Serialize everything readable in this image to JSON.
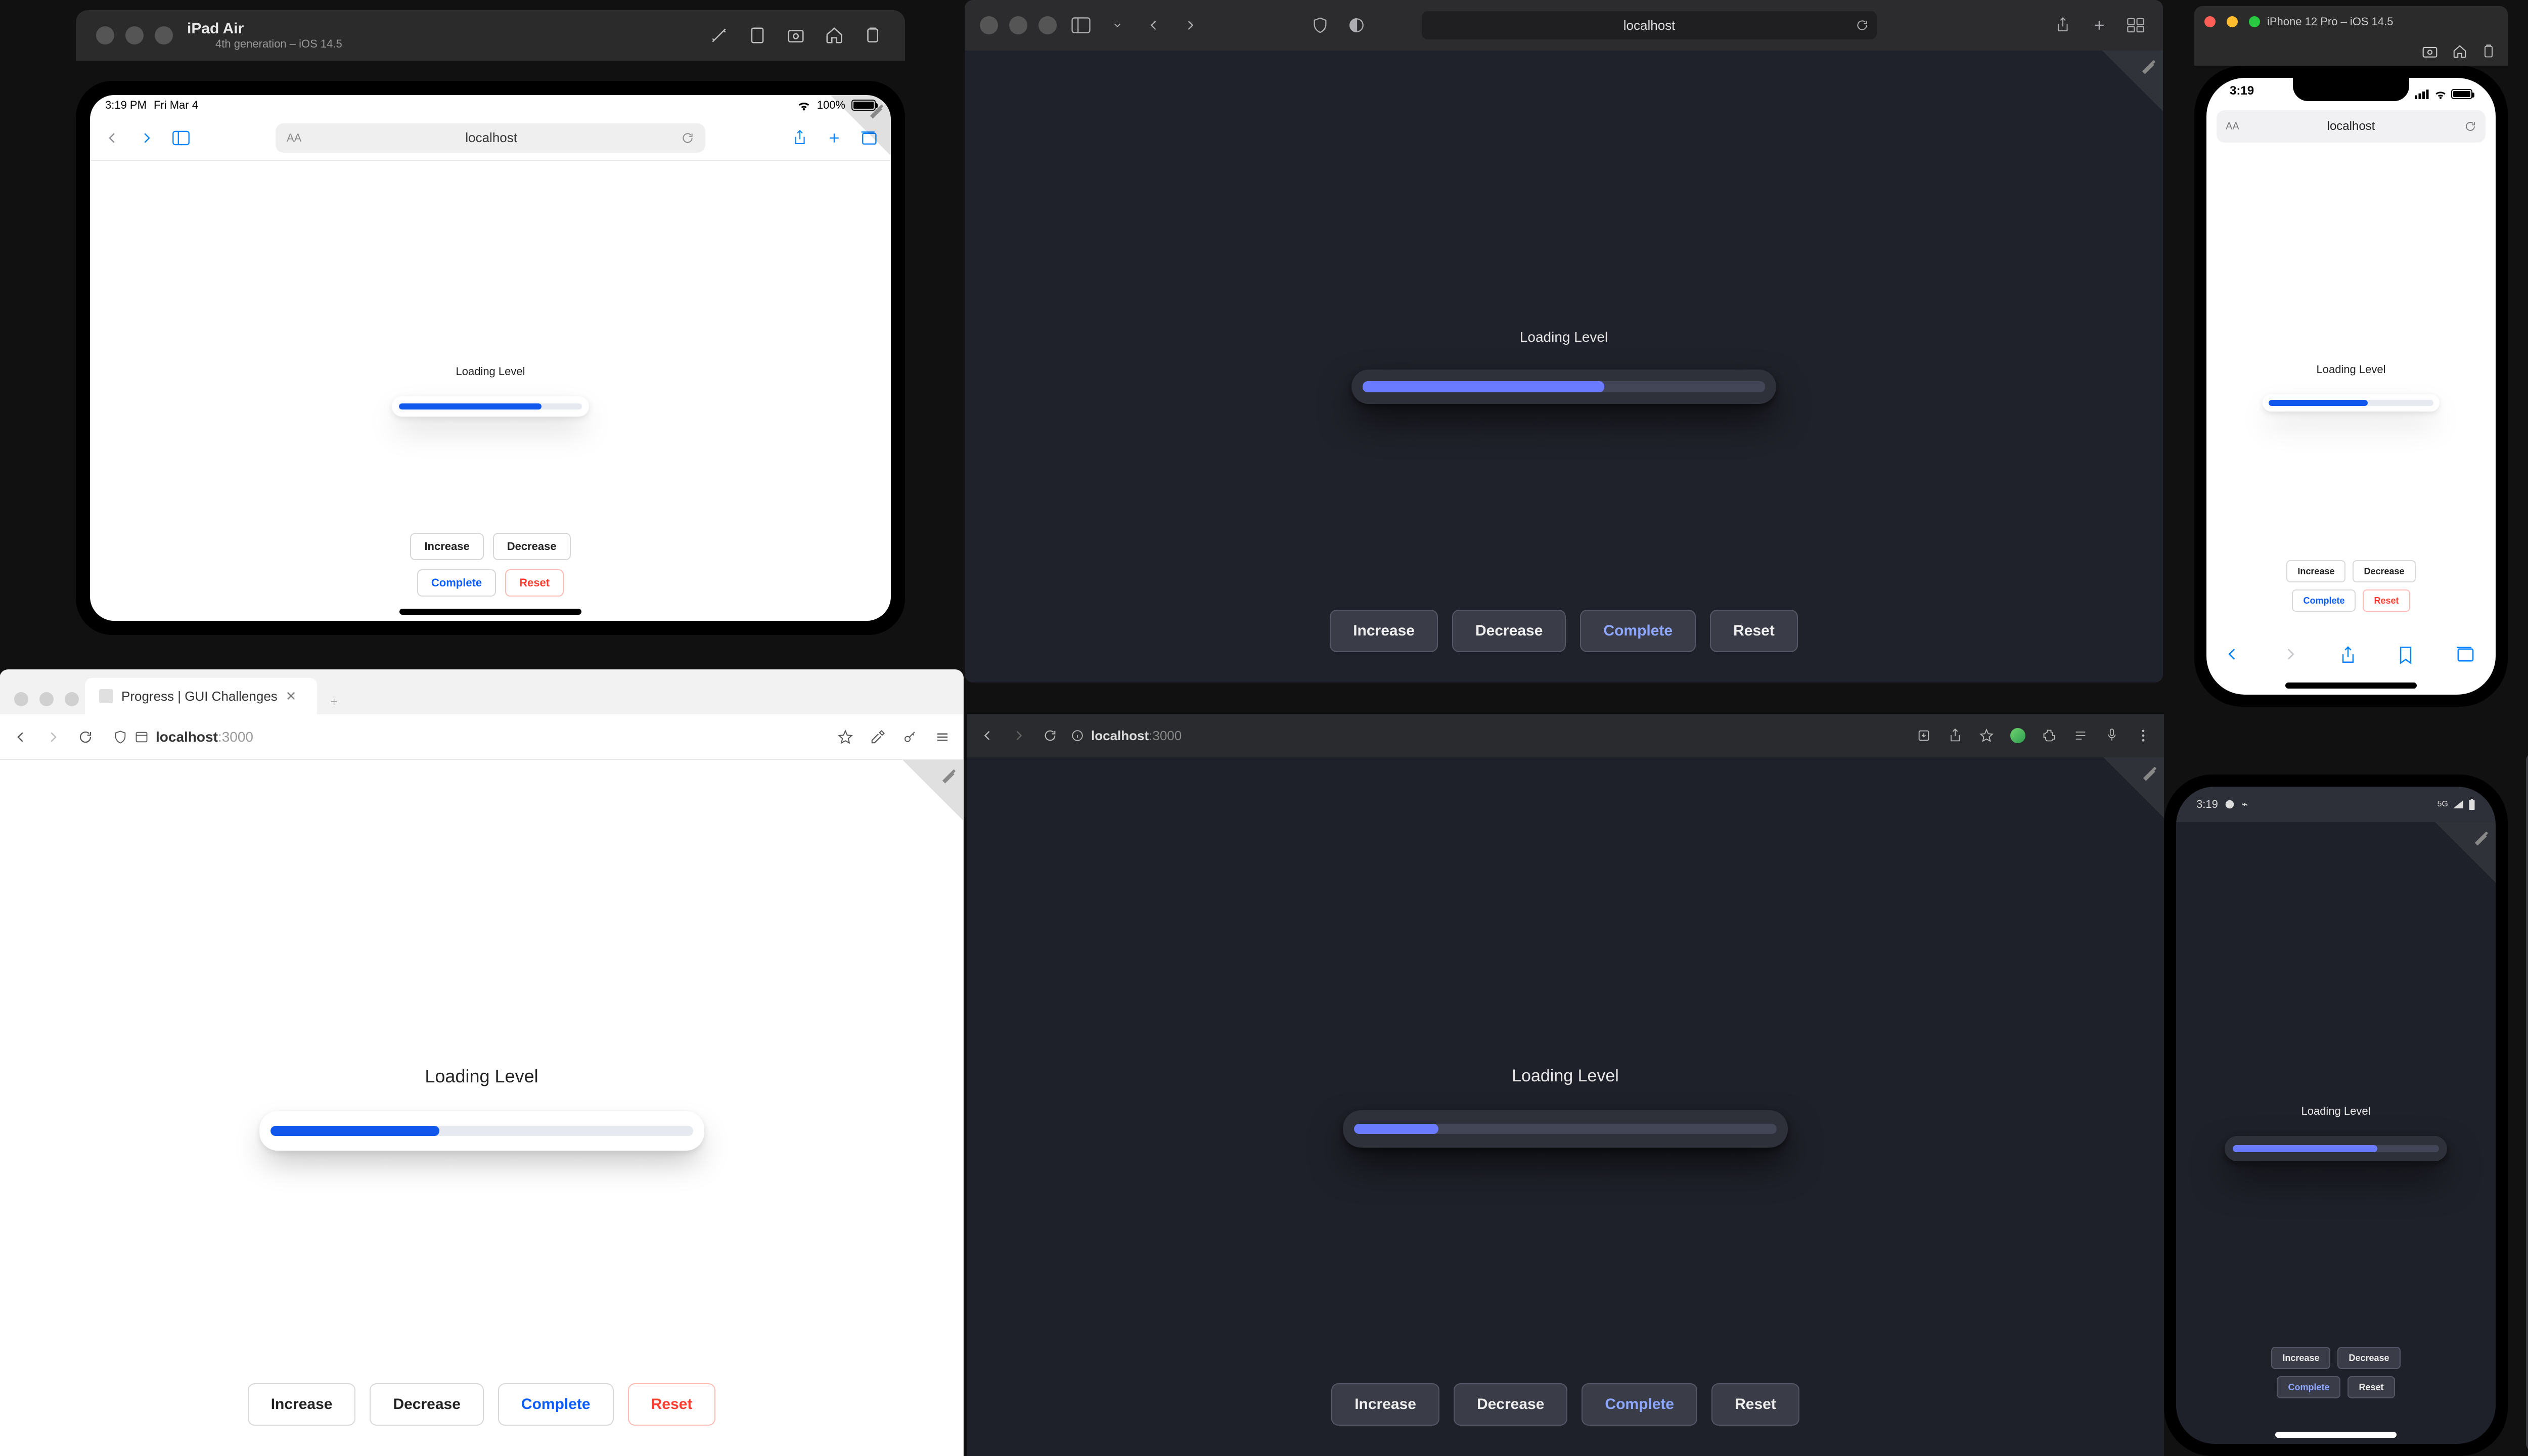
{
  "demo": {
    "label": "Loading Level",
    "buttons": {
      "increase": "Increase",
      "decrease": "Decrease",
      "complete": "Complete",
      "reset": "Reset"
    }
  },
  "url": {
    "host": "localhost",
    "port": ":3000"
  },
  "ipad_sim": {
    "title": "iPad Air",
    "subtitle": "4th generation – iOS 14.5",
    "status_time": "3:19 PM",
    "status_date": "Fri Mar 4",
    "battery_text": "100%",
    "progress_pct": 78
  },
  "iphone_sim": {
    "title": "iPhone 12 Pro – iOS 14.5",
    "status_time": "3:19",
    "progress_pct": 60
  },
  "safari_top": {
    "progress_pct": 60
  },
  "safari_bottom": {
    "progress_pct": 20
  },
  "chrome_light": {
    "tab_title": "Progress | GUI Challenges",
    "progress_pct": 40
  },
  "android": {
    "status_time": "3:19",
    "progress_pct": 70
  }
}
